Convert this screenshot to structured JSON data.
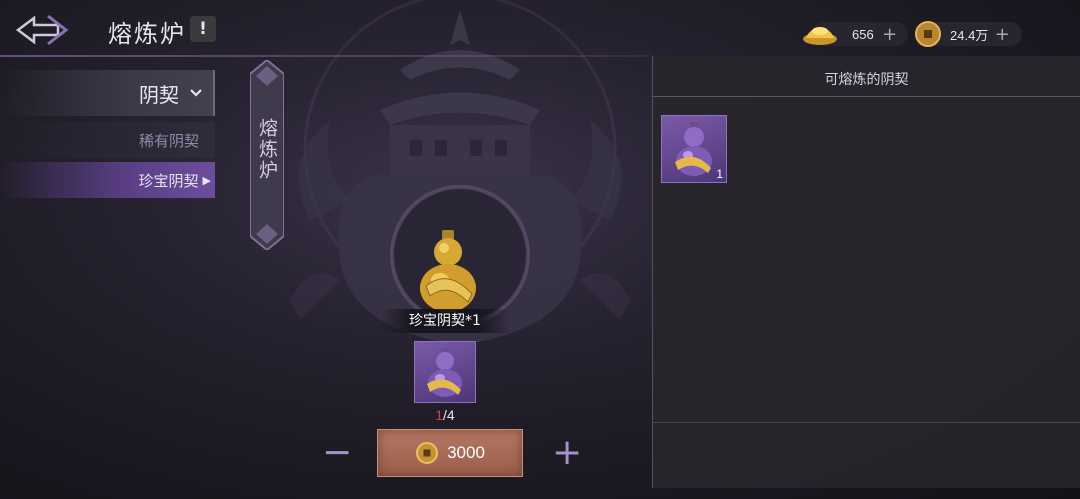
{
  "header": {
    "title": "熔炼炉",
    "info_label": "!",
    "currencies": [
      {
        "icon": "gold-ingot-icon",
        "value": "656",
        "plus": "+"
      },
      {
        "icon": "copper-coin-icon",
        "value": "24.4万",
        "plus": "+"
      }
    ]
  },
  "menu": {
    "main_label": "阴契",
    "subs": [
      {
        "label": "稀有阴契",
        "selected": false
      },
      {
        "label": "珍宝阴契",
        "selected": true,
        "arrow": "▶"
      }
    ]
  },
  "banner": {
    "text": "熔炼炉"
  },
  "result": {
    "label": "珍宝阴契*1"
  },
  "material": {
    "current": "1",
    "sep_total": "/4"
  },
  "controls": {
    "minus": "−",
    "plus": "+",
    "cost": "3000"
  },
  "panel": {
    "title": "可熔炼的阴契",
    "items": [
      {
        "icon": "purple-gourd-icon",
        "qty": "1"
      }
    ]
  },
  "colors": {
    "accent_purple": "#6c4e9c",
    "button_bg": "#b47762",
    "count_red": "#e03a3a"
  }
}
